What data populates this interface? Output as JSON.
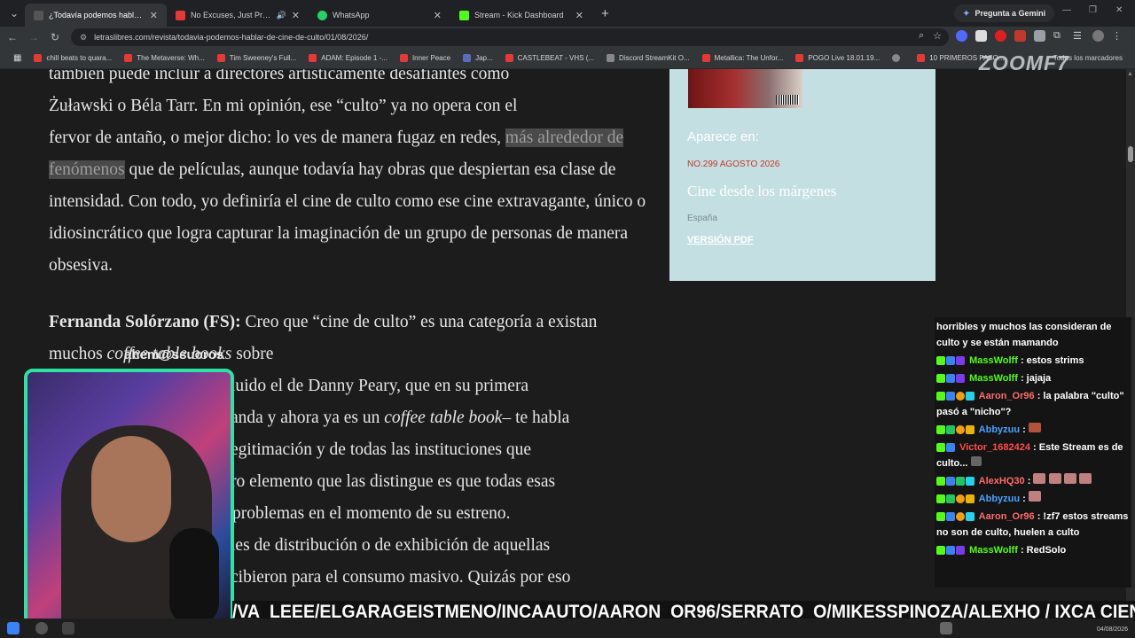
{
  "browser": {
    "tabs": [
      {
        "label": "¿Todavía podemos hablar de c",
        "active": true,
        "fav_color": "#555"
      },
      {
        "label": "No Excuses, Just Progress",
        "active": false,
        "fav_color": "#e53935"
      },
      {
        "label": "WhatsApp",
        "active": false,
        "fav_color": "#25d366"
      },
      {
        "label": "Stream - Kick Dashboard",
        "active": false,
        "fav_color": "#53fc18"
      }
    ],
    "gemini_label": "Pregunta a Gemini",
    "url": "letraslibres.com/revista/todavia-podemos-hablar-de-cine-de-culto/01/08/2026/",
    "bookmarks": [
      {
        "label": "chill beats to quara...",
        "color": "#e53935"
      },
      {
        "label": "The Metaverse: Wh...",
        "color": "#e53935"
      },
      {
        "label": "Tim Sweeney's Full...",
        "color": "#e53935"
      },
      {
        "label": "ADAM: Episode 1 -...",
        "color": "#e53935"
      },
      {
        "label": "Inner Peace",
        "color": "#e53935"
      },
      {
        "label": "Jap...",
        "color": "#5c6bc0"
      },
      {
        "label": "CASTLEBEAT - VHS (...",
        "color": "#e53935"
      },
      {
        "label": "Discord StreamKit O...",
        "color": "#888"
      },
      {
        "label": "Metallica: The Unfor...",
        "color": "#e53935"
      },
      {
        "label": "POGO Live 18.01.19...",
        "color": "#e53935"
      },
      {
        "label": "",
        "color": "#888"
      },
      {
        "label": "10 PRIMEROS PASO...",
        "color": "#e53935"
      }
    ],
    "bookmarks_all": "Todos los marcadores"
  },
  "article": {
    "para1_lines": [
      "también puede incluir a directores artísticamente desafiantes como",
      "Żuławski o Béla Tarr. En mi opinión, ese “culto” ya no opera con el"
    ],
    "para1_pre_hl": "fervor de antaño, o mejor dicho: lo ves de manera fugaz en redes,",
    "para1_hl": "más alrededor de fenómenos",
    "para1_post": "que de películas, aunque todavía hay obras que despiertan esa clase de intensidad. Con todo, yo definiría el cine de culto como ese cine extravagante, único o idiosincrático que logra capturar la imaginación de un grupo de personas de manera obsesiva.",
    "para2_speaker": "Fernanda Solórzano (FS):",
    "para2_a": "Creo que “cine de culto” es una categoría",
    "para2_b": "a existan muchos",
    "para2_em1": "coffee table books",
    "para2_c": "sobre",
    "para2_lines": [
      "luido el de Danny Peary, que en su primera"
    ],
    "para2_d": "anda y ahora ya es un",
    "para2_em2": "coffee table book",
    "para2_e": "– te habla",
    "para2_lines2": [
      "egitimación y de todas las instituciones que",
      "ro elemento que las distingue es que todas esas",
      "problemas en el momento de su estreno.",
      "les de distribución o de exhibición de aquellas",
      "cibieron para el consumo masivo. Quizás por eso"
    ]
  },
  "sidebar": {
    "appears_in": "Aparece en:",
    "issue": "NO.299 AGOSTO 2026",
    "section_title": "Cine desde los márgenes",
    "country": "España",
    "pdf_link": "VERSIÓN PDF"
  },
  "chat": {
    "messages": [
      {
        "user": "",
        "text": "horribles y muchos las consideran de culto y se están mamando",
        "color": "#fff"
      },
      {
        "user": "MassWolff",
        "text": ": estos strims",
        "color": "#53fc18"
      },
      {
        "user": "MassWolff",
        "text": ": jajaja",
        "color": "#53fc18"
      },
      {
        "user": "Aaron_Or96",
        "text": ": la palabra \"culto\" pasó a \"nicho\"?",
        "color": "#ff6b6b"
      },
      {
        "user": "Abbyzuu",
        "text": ":",
        "color": "#4aa3ff"
      },
      {
        "user": "Victor_1682424",
        "text": ": Este Stream es de culto...",
        "color": "#ff4d4d"
      },
      {
        "user": "AlexHQ30",
        "text": ":",
        "color": "#ff6b6b"
      },
      {
        "user": "Abbyzuu",
        "text": ":",
        "color": "#4aa3ff"
      },
      {
        "user": "Aaron_Or96",
        "text": ": !zf7 estos streams no son de culto, huelen a culto",
        "color": "#ff6b6b"
      },
      {
        "user": "MassWolff",
        "text": ": RedSolo",
        "color": "#53fc18"
      }
    ]
  },
  "stream": {
    "watermark": "ZOOMF7",
    "cam_label": "ahem@ssuoros",
    "ticker": "/VA_LEEE/ELGARAGEISTMENO/INCAAUTO/AARON_OR96/SERRATO_O/MIKESSPINOZA/ALEXHQ / IXCA CIENFUEGOS/ HIPOLIO /E",
    "accent": "#2de3a4"
  },
  "taskbar": {
    "date": "04/08/2026"
  }
}
